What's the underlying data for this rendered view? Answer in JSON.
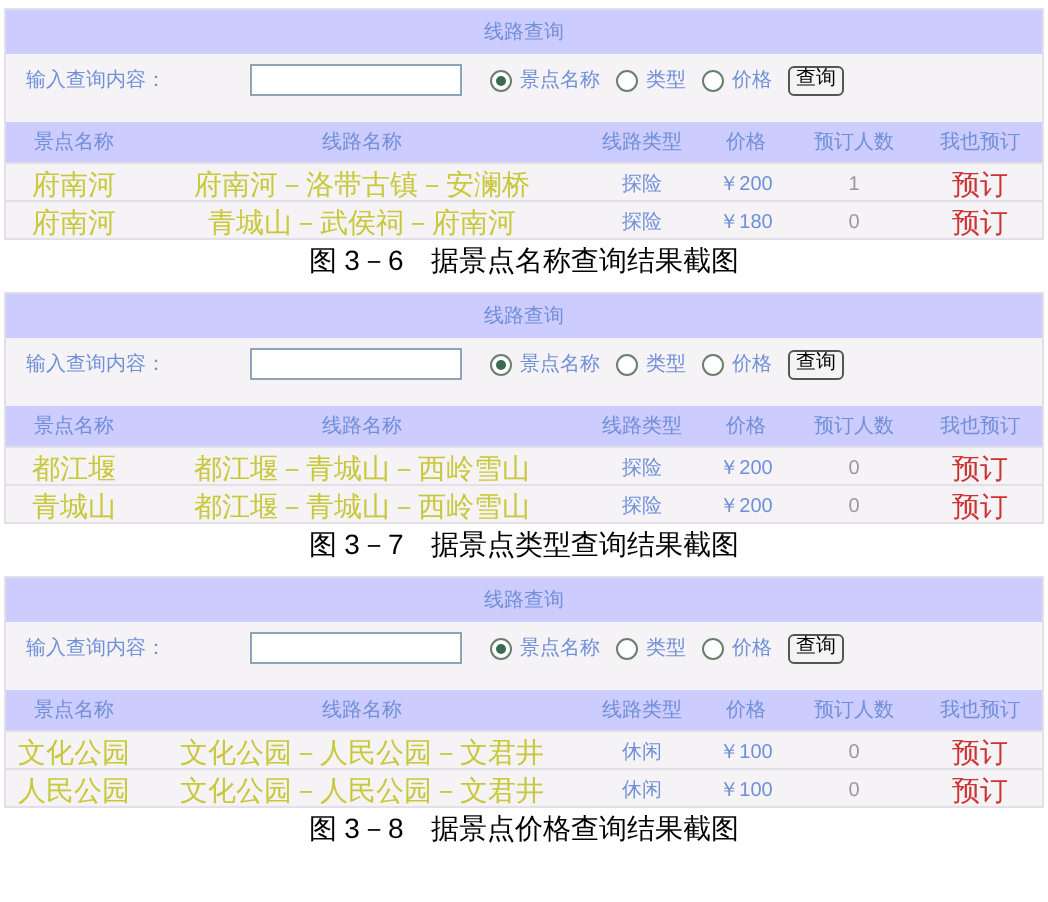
{
  "figures": [
    {
      "title": "线路查询",
      "search": {
        "label": "输入查询内容：",
        "radios": [
          {
            "label": "景点名称",
            "selected": true
          },
          {
            "label": "类型",
            "selected": false
          },
          {
            "label": "价格",
            "selected": false
          }
        ],
        "button": "查询"
      },
      "table": {
        "columns": [
          "景点名称",
          "线路名称",
          "线路类型",
          "价格",
          "预订人数",
          "我也预订"
        ],
        "rows": [
          [
            "府南河",
            "府南河－洛带古镇－安澜桥",
            "探险",
            "￥200",
            "1",
            "预订"
          ],
          [
            "府南河",
            "青城山－武侯祠－府南河",
            "探险",
            "￥180",
            "0",
            "预订"
          ]
        ]
      },
      "caption": "图 3－6　据景点名称查询结果截图"
    },
    {
      "title": "线路查询",
      "search": {
        "label": "输入查询内容：",
        "radios": [
          {
            "label": "景点名称",
            "selected": true
          },
          {
            "label": "类型",
            "selected": false
          },
          {
            "label": "价格",
            "selected": false
          }
        ],
        "button": "查询"
      },
      "table": {
        "columns": [
          "景点名称",
          "线路名称",
          "线路类型",
          "价格",
          "预订人数",
          "我也预订"
        ],
        "rows": [
          [
            "都江堰",
            "都江堰－青城山－西岭雪山",
            "探险",
            "￥200",
            "0",
            "预订"
          ],
          [
            "青城山",
            "都江堰－青城山－西岭雪山",
            "探险",
            "￥200",
            "0",
            "预订"
          ]
        ]
      },
      "caption": "图 3－7　据景点类型查询结果截图"
    },
    {
      "title": "线路查询",
      "search": {
        "label": "输入查询内容：",
        "radios": [
          {
            "label": "景点名称",
            "selected": true
          },
          {
            "label": "类型",
            "selected": false
          },
          {
            "label": "价格",
            "selected": false
          }
        ],
        "button": "查询"
      },
      "table": {
        "columns": [
          "景点名称",
          "线路名称",
          "线路类型",
          "价格",
          "预订人数",
          "我也预订"
        ],
        "rows": [
          [
            "文化公园",
            "文化公园－人民公园－文君井",
            "休闲",
            "￥100",
            "0",
            "预订"
          ],
          [
            "人民公园",
            "文化公园－人民公园－文君井",
            "休闲",
            "￥100",
            "0",
            "预订"
          ]
        ]
      },
      "caption": "图 3－8　据景点价格查询结果截图"
    }
  ]
}
